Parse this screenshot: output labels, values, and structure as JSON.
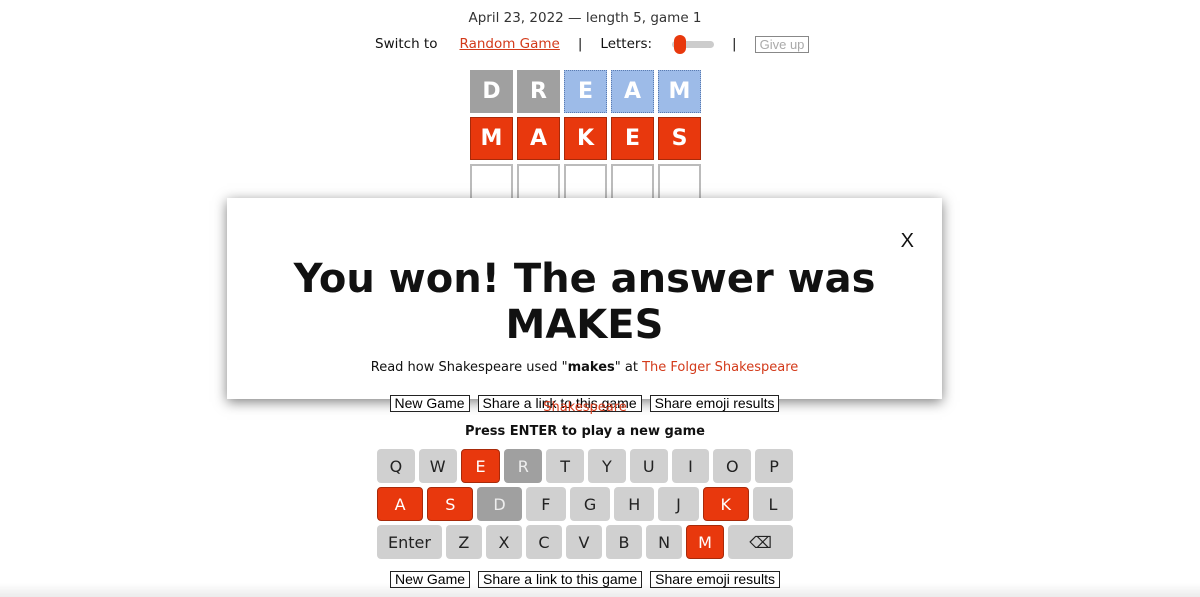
{
  "subtitle": "April 23, 2022 — length 5, game 1",
  "controls": {
    "switch_to": "Switch to",
    "random_game": "Random Game",
    "sep": "|",
    "letters": "Letters:",
    "letters_value": 5,
    "give_up": "Give up"
  },
  "board": [
    [
      {
        "l": "D",
        "s": "absent"
      },
      {
        "l": "R",
        "s": "absent"
      },
      {
        "l": "E",
        "s": "present"
      },
      {
        "l": "A",
        "s": "present"
      },
      {
        "l": "M",
        "s": "present"
      }
    ],
    [
      {
        "l": "M",
        "s": "correct"
      },
      {
        "l": "A",
        "s": "correct"
      },
      {
        "l": "K",
        "s": "correct"
      },
      {
        "l": "E",
        "s": "correct"
      },
      {
        "l": "S",
        "s": "correct"
      }
    ],
    [
      {
        "l": "",
        "s": "empty"
      },
      {
        "l": "",
        "s": "empty"
      },
      {
        "l": "",
        "s": "empty"
      },
      {
        "l": "",
        "s": "empty"
      },
      {
        "l": "",
        "s": "empty"
      }
    ]
  ],
  "modal": {
    "close": "X",
    "title": "You won! The answer was MAKES",
    "read_pre": "Read how Shakespeare used \"",
    "word": "makes",
    "read_mid": "\" at ",
    "link": "The Folger Shakespeare",
    "buttons": [
      "New Game",
      "Share a link to this game",
      "Share emoji results"
    ]
  },
  "behind_link": "Shakespeare",
  "press_enter": "Press ENTER to play a new game",
  "keyboard": [
    [
      [
        "Q",
        ""
      ],
      [
        "W",
        ""
      ],
      [
        "E",
        "hit"
      ],
      [
        "R",
        "miss"
      ],
      [
        "T",
        ""
      ],
      [
        "Y",
        ""
      ],
      [
        "U",
        ""
      ],
      [
        "I",
        ""
      ],
      [
        "O",
        ""
      ],
      [
        "P",
        ""
      ]
    ],
    [
      [
        "A",
        "hit w"
      ],
      [
        "S",
        "hit w"
      ],
      [
        "D",
        "miss w"
      ],
      [
        "F",
        ""
      ],
      [
        "G",
        ""
      ],
      [
        "H",
        ""
      ],
      [
        "J",
        ""
      ],
      [
        "K",
        "hit w"
      ],
      [
        "L",
        ""
      ]
    ],
    [
      [
        "Enter",
        "x"
      ],
      [
        "Z",
        ""
      ],
      [
        "X",
        ""
      ],
      [
        "C",
        ""
      ],
      [
        "V",
        ""
      ],
      [
        "B",
        ""
      ],
      [
        "N",
        ""
      ],
      [
        "M",
        "hit"
      ],
      [
        "⌫",
        "x"
      ]
    ]
  ],
  "bottom_buttons": [
    "New Game",
    "Share a link to this game",
    "Share emoji results"
  ],
  "colors": {
    "correct": "#e8380d",
    "present": "#9dbbe8",
    "absent": "#a0a0a0",
    "key": "#d0d0d0"
  }
}
